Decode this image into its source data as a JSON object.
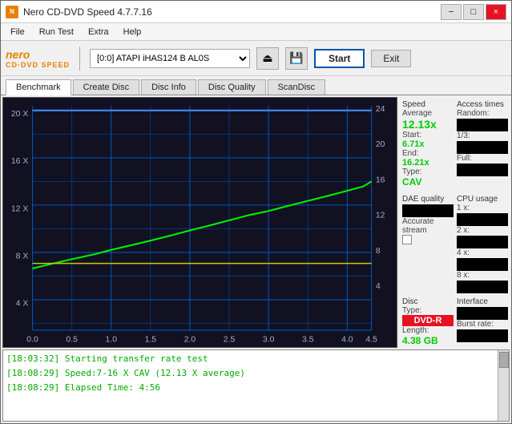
{
  "window": {
    "title": "Nero CD-DVD Speed 4.7.7.16",
    "controls": [
      "−",
      "□",
      "×"
    ]
  },
  "menu": {
    "items": [
      "File",
      "Run Test",
      "Extra",
      "Help"
    ]
  },
  "toolbar": {
    "logo_top": "nero",
    "logo_bottom": "CD·DVD SPEED",
    "drive_label": "[0:0]  ATAPI iHAS124  B AL0S",
    "start_label": "Start",
    "exit_label": "Exit"
  },
  "tabs": [
    {
      "label": "Benchmark",
      "active": true
    },
    {
      "label": "Create Disc",
      "active": false
    },
    {
      "label": "Disc Info",
      "active": false
    },
    {
      "label": "Disc Quality",
      "active": false
    },
    {
      "label": "ScanDisc",
      "active": false
    }
  ],
  "speed_panel": {
    "header": "Speed",
    "average_label": "Average",
    "average_value": "12.13x",
    "start_label": "Start:",
    "start_value": "6.71x",
    "end_label": "End:",
    "end_value": "16.21x",
    "type_label": "Type:",
    "type_value": "CAV"
  },
  "access_times": {
    "header": "Access times",
    "random_label": "Random:",
    "one_third_label": "1/3:",
    "full_label": "Full:"
  },
  "cpu_usage": {
    "header": "CPU usage",
    "1x_label": "1 x:",
    "2x_label": "2 x:",
    "4x_label": "4 x:",
    "8x_label": "8 x:"
  },
  "dae_quality": {
    "header": "DAE quality",
    "accurate_stream_label": "Accurate",
    "accurate_stream_label2": "stream"
  },
  "disc": {
    "type_header": "Disc",
    "type_label": "Type:",
    "type_value": "DVD-R",
    "length_label": "Length:",
    "length_value": "4.38 GB"
  },
  "interface": {
    "header": "Interface",
    "burst_label": "Burst rate:"
  },
  "chart": {
    "y_axis_labels": [
      "20 X",
      "16 X",
      "12 X",
      "8 X",
      "4 X"
    ],
    "y_axis_right": [
      "24",
      "20",
      "16",
      "12",
      "8",
      "4"
    ],
    "x_axis_labels": [
      "0.0",
      "0.5",
      "1.0",
      "1.5",
      "2.0",
      "2.5",
      "3.0",
      "3.5",
      "4.0",
      "4.5"
    ]
  },
  "status_log": {
    "lines": [
      "[18:03:32]  Starting transfer rate test",
      "[18:08:29]  Speed:7-16 X CAV (12.13 X average)",
      "[18:08:29]  Elapsed Time: 4:56"
    ]
  }
}
